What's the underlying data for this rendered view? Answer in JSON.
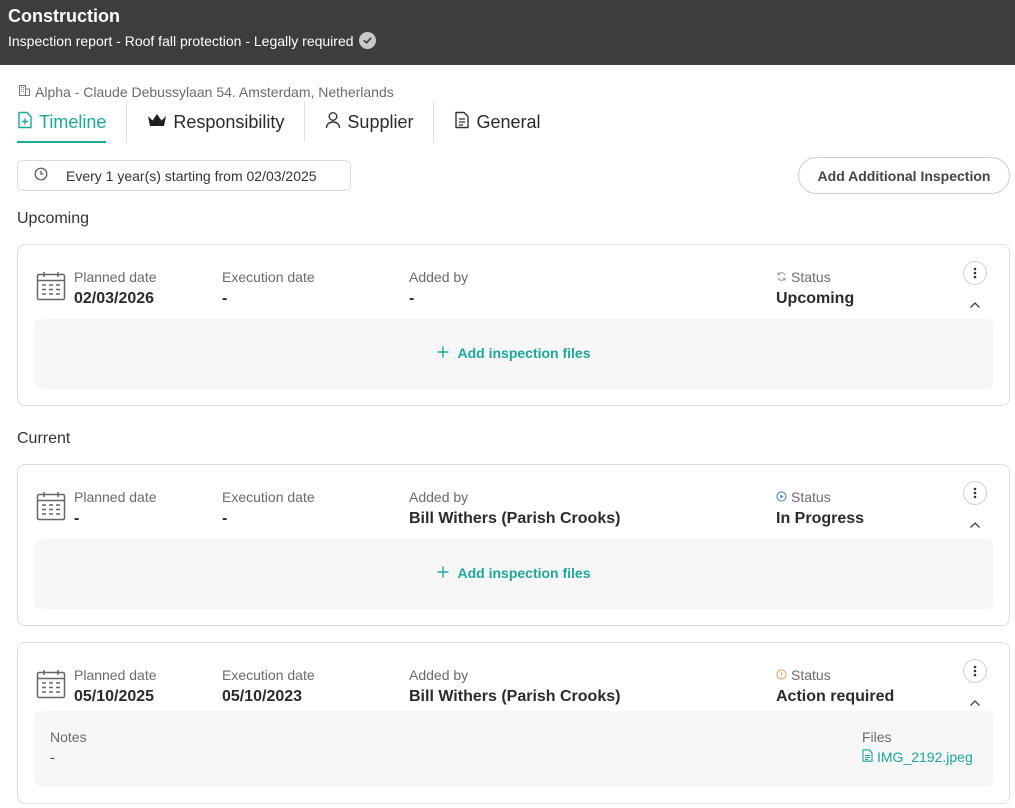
{
  "header": {
    "title": "Construction",
    "subtitle": "Inspection report - Roof fall protection - Legally required",
    "verified_icon": "check-badge-icon"
  },
  "location": {
    "icon": "building-icon",
    "address": "Alpha - Claude Debussylaan 54. Amsterdam, Netherlands"
  },
  "tabs": [
    {
      "label": "Timeline",
      "icon": "file-plus-icon",
      "active": true
    },
    {
      "label": "Responsibility",
      "icon": "crown-icon",
      "active": false
    },
    {
      "label": "Supplier",
      "icon": "person-icon",
      "active": false
    },
    {
      "label": "General",
      "icon": "document-icon",
      "active": false
    }
  ],
  "schedule": {
    "icon": "clock-icon",
    "text": "Every 1 year(s) starting from 02/03/2025"
  },
  "actions": {
    "add_additional_inspection": "Add Additional Inspection"
  },
  "sections": {
    "upcoming": "Upcoming",
    "current": "Current"
  },
  "labels": {
    "planned_date": "Planned date",
    "execution_date": "Execution date",
    "added_by": "Added by",
    "status": "Status",
    "add_files": "Add inspection files",
    "notes": "Notes",
    "files": "Files"
  },
  "inspections": [
    {
      "planned_date": "02/03/2026",
      "execution_date": "-",
      "added_by": "-",
      "status": "Upcoming",
      "status_icon": "refresh-icon",
      "status_color": "#9a9a9a"
    },
    {
      "planned_date": "-",
      "execution_date": "-",
      "added_by": "Bill Withers (Parish Crooks)",
      "status": "In Progress",
      "status_icon": "play-circle-icon",
      "status_color": "#3b82c4"
    },
    {
      "planned_date": "05/10/2025",
      "execution_date": "05/10/2023",
      "added_by": "Bill Withers (Parish Crooks)",
      "status": "Action required",
      "status_icon": "alert-circle-icon",
      "status_color": "#e0a060",
      "notes": "-",
      "file_name": "IMG_2192.jpeg"
    }
  ],
  "colors": {
    "accent": "#1aa89a",
    "header_bg": "#3d3d3d"
  }
}
